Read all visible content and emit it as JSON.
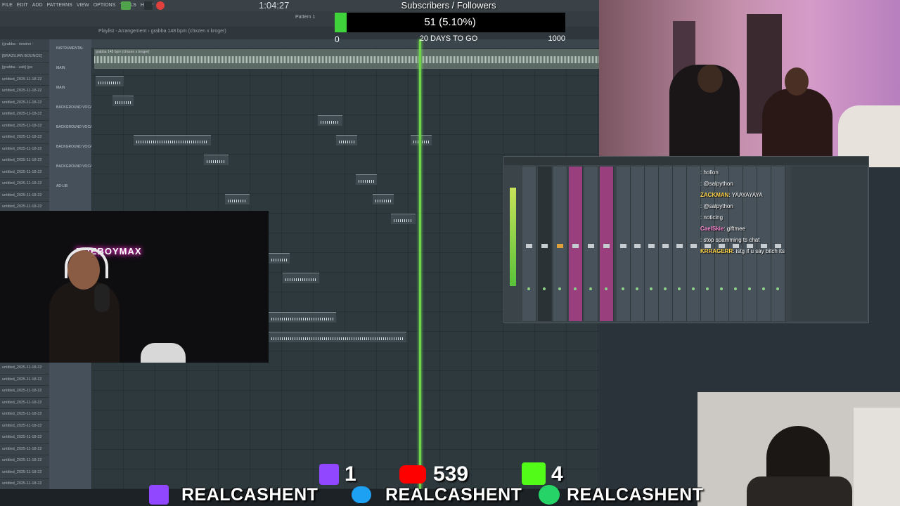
{
  "fl": {
    "menu": [
      "FILE",
      "EDIT",
      "ADD",
      "PATTERNS",
      "VIEW",
      "OPTIONS",
      "TOOLS",
      "HELP"
    ],
    "time": "1:04:27",
    "pattern": "Pattern 1",
    "playlist_title": "Playlist - Arrangement › grabba 148 bpm (chxzen x kroger)",
    "tracklist": [
      "(grabba - newinn -",
      "[BRAZILIAN BOUNCE]",
      "[grabba - sab] (pe",
      "untitled_2025-11-18-22",
      "untitled_2025-11-18-22",
      "untitled_2025-11-18-22",
      "untitled_2025-11-18-22",
      "untitled_2025-11-18-22",
      "untitled_2025-11-18-22",
      "untitled_2025-11-18-22",
      "untitled_2025-11-18-22",
      "untitled_2025-11-18-22",
      "untitled_2025-11-18-22",
      "untitled_2025-11-18-22",
      "untitled_2025-11-18-22"
    ],
    "tracklist2": [
      "untitled_2025-11-18-22",
      "untitled_2025-11-18-22",
      "untitled_2025-11-18-22",
      "untitled_2025-11-18-22",
      "untitled_2025-11-18-22",
      "untitled_2025-11-18-22",
      "untitled_2025-11-18-22",
      "untitled_2025-11-18-22",
      "untitled_2025-11-18-22",
      "untitled_2025-11-18-22",
      "untitled_2025-11-18-22"
    ],
    "tracknames": [
      "INSTRUMENTAL",
      "MAIN",
      "MAIN",
      "BACKGROUND VOCAL",
      "BACKGROUND VOCAL",
      "BACKGROUND VOCAL",
      "BACKGROUND VOCAL",
      "AD-LIB"
    ],
    "top_clip": "grabba 148 bpm (chxzen x kroger)"
  },
  "goal": {
    "title": "Subscribers / Followers",
    "count": "51 (5.10%)",
    "progress_percent": 5.1,
    "min": "0",
    "days": "20 DAYS TO GO",
    "max": "1000",
    "fill_color": "#3fd23a"
  },
  "cam_left_logo": "RUEBOYMAX",
  "chat": [
    {
      "user": "",
      "msg": ": hollon",
      "color": "#ff4da6"
    },
    {
      "user": "",
      "msg": ": @salpython",
      "color": "#ff4da6"
    },
    {
      "user": "ZACKMAN",
      "msg": ": YAAYAYAYA",
      "color": "#ffd54a"
    },
    {
      "user": "",
      "msg": ": @salpython",
      "color": "#4d9dff"
    },
    {
      "user": "",
      "msg": ": noticing",
      "color": "#ff4da6"
    },
    {
      "user": "CaelSkie",
      "msg": ": giftmee",
      "color": "#ff8ad4"
    },
    {
      "user": "",
      "msg": ": stop spamming ts chat",
      "color": "#ff4d4d"
    },
    {
      "user": "KRRAGERR",
      "msg": ": istg if u say bitch its",
      "color": "#ffd54a"
    }
  ],
  "socials": {
    "twitch_count": "1",
    "youtube_count": "539",
    "kick_count": "4",
    "handle_1": "REALCASHENT",
    "handle_2": "REALCASHENT",
    "handle_3": "REALCASHENT",
    "twitch_color": "#9146ff",
    "youtube_color": "#ff0000",
    "kick_color": "#53fc18",
    "twitter_color": "#1da1f2",
    "whatsapp_color": "#25d366"
  }
}
